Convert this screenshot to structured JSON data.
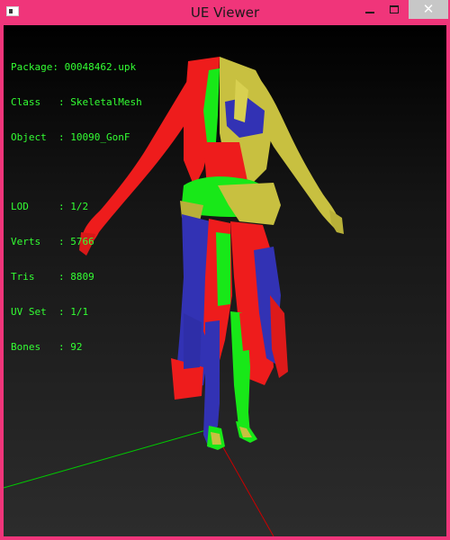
{
  "window": {
    "title": "UE Viewer",
    "controls": {
      "minimize": "",
      "maximize": "",
      "close": "✕"
    }
  },
  "info": {
    "package_label": "Package: ",
    "package": "00048462.upk",
    "class_label": "Class   : ",
    "class": "SkeletalMesh",
    "object_label": "Object  : ",
    "object": "10090_GonF",
    "lod_label": "LOD     : ",
    "lod": "1/2",
    "verts_label": "Verts   : ",
    "verts": "5766",
    "tris_label": "Tris    : ",
    "tris": "8809",
    "uvset_label": "UV Set  : ",
    "uvset": "1/1",
    "bones_label": "Bones   : ",
    "bones": "92"
  },
  "colors": {
    "title_bar": "#f0357a",
    "info_text": "#33ff33",
    "mesh_red": "#ee1c1c",
    "mesh_green": "#18e818",
    "mesh_blue": "#3232b4",
    "mesh_yellow": "#c8c040",
    "axis_x": "#cc0000",
    "axis_y": "#00cc00",
    "axis_z": "#2a4ad0"
  }
}
